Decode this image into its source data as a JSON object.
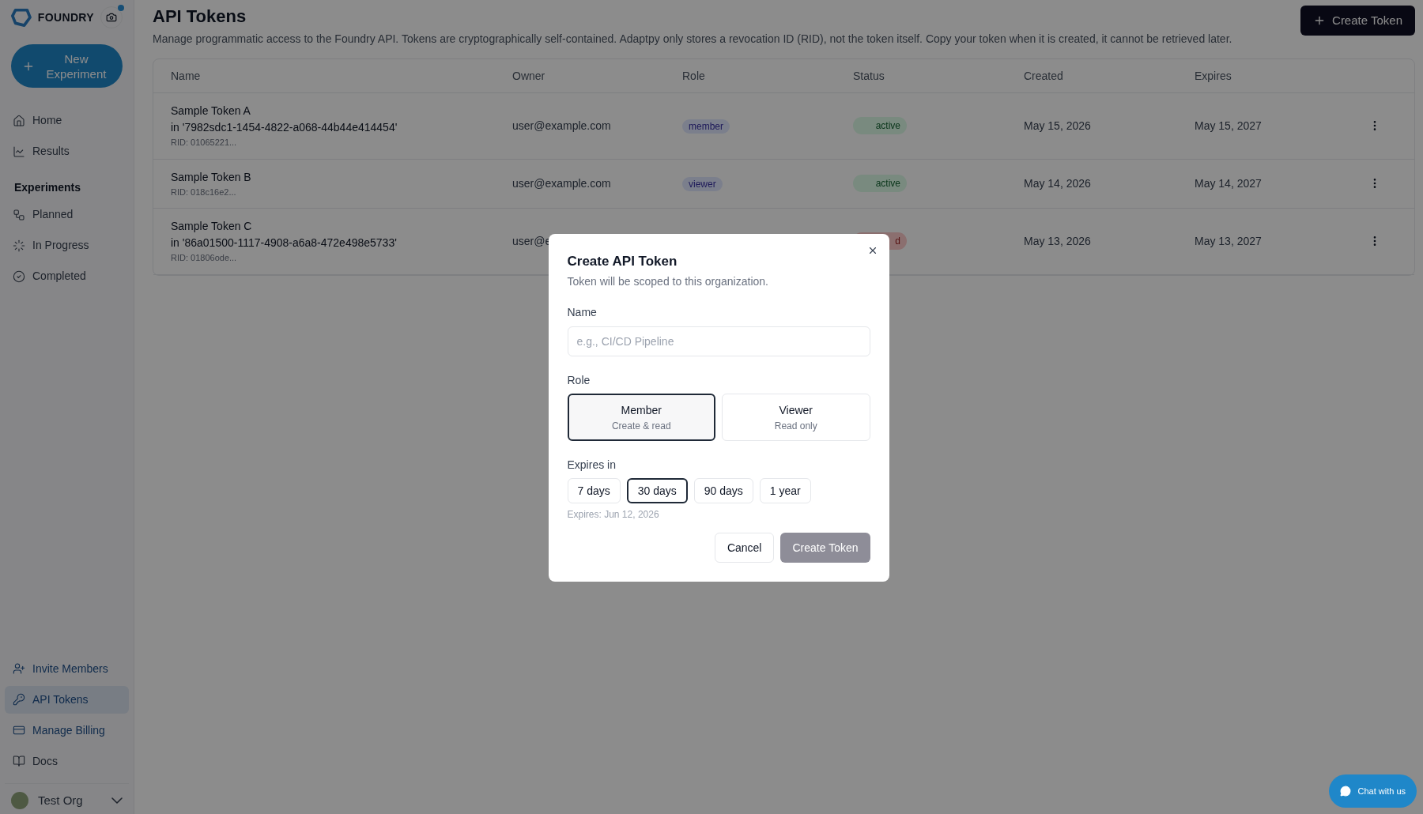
{
  "sidebar": {
    "brand": "FOUNDRY",
    "new_button": "New Experiment",
    "nav": [
      {
        "label": "Home",
        "selected": false
      },
      {
        "label": "Results",
        "selected": false
      }
    ],
    "section": "Experiments",
    "experiments": [
      {
        "label": "Planned",
        "selected": false
      },
      {
        "label": "In Progress",
        "selected": false
      },
      {
        "label": "Completed",
        "selected": false
      }
    ],
    "bottom": [
      {
        "label": "Invite Members",
        "selected": false
      },
      {
        "label": "API Tokens",
        "selected": true
      },
      {
        "label": "Manage Billing",
        "selected": false
      },
      {
        "label": "Docs",
        "selected": false
      }
    ],
    "org": "Test Org"
  },
  "page": {
    "title": "API Tokens",
    "description": "Manage programmatic access to the Foundry API. Tokens are cryptographically self-contained. Adaptpy only stores a revocation ID (RID), not the token itself. Copy your token when it is created, it cannot be retrieved later.",
    "create_button": "Create Token"
  },
  "table": {
    "columns": [
      "Name",
      "Owner",
      "Role",
      "Status",
      "Created",
      "Expires"
    ],
    "rows": [
      {
        "name": "Sample Token A",
        "scope": "in '7982sdc1-1454-4822-a068-44b44e414454'",
        "rid": "RID: 01065221...",
        "owner": "user@example.com",
        "role": "member",
        "status": "active",
        "kind": "success",
        "created": "May 15, 2026",
        "expires": "May 15, 2027"
      },
      {
        "name": "Sample Token B",
        "rid": "RID: 018c16e2...",
        "owner": "user@example.com",
        "role": "viewer",
        "status": "active",
        "kind": "success",
        "created": "May 14, 2026",
        "expires": "May 14, 2027"
      },
      {
        "name": "Sample Token C",
        "scope": "in '86a01500-1117-4908-a6a8-472e498e5733'",
        "rid": "RID: 01806ode...",
        "owner": "user@e",
        "status": "d",
        "kind": "danger",
        "created": "May 13, 2026",
        "expires": "May 13, 2027"
      }
    ]
  },
  "dialog": {
    "title": "Create API Token",
    "subtitle": "Token will be scoped to this organization.",
    "name_label": "Name",
    "name_placeholder": "e.g., CI/CD Pipeline",
    "role_label": "Role",
    "roles": [
      {
        "label": "Member",
        "hint": "Create & read",
        "selected": true
      },
      {
        "label": "Viewer",
        "hint": "Read only",
        "selected": false
      }
    ],
    "expires_label": "Expires in",
    "expiry_options": [
      {
        "label": "7 days",
        "selected": false
      },
      {
        "label": "30 days",
        "selected": true
      },
      {
        "label": "90 days",
        "selected": false
      },
      {
        "label": "1 year",
        "selected": false
      }
    ],
    "expires_note": "Expires: Jun 12, 2026",
    "cancel": "Cancel",
    "submit": "Create Token",
    "submit_disabled": true
  },
  "chat_button": "Chat with us"
}
